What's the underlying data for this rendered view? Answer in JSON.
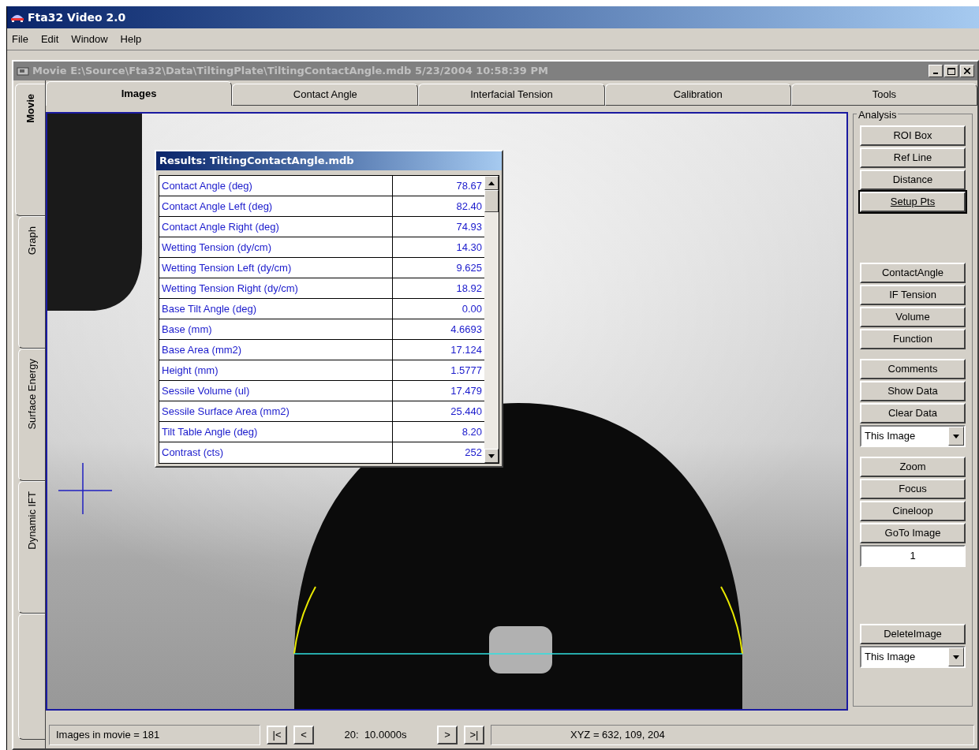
{
  "app": {
    "title": "Fta32 Video 2.0"
  },
  "menu": [
    "File",
    "Edit",
    "Window",
    "Help"
  ],
  "document": {
    "title": "Movie E:\\Source\\Fta32\\Data\\TiltingPlate\\TiltingContactAngle.mdb 5/23/2004 10:58:39 PM"
  },
  "side_tabs": [
    {
      "label": "Movie",
      "selected": true
    },
    {
      "label": "Graph",
      "selected": false
    },
    {
      "label": "Surface Energy",
      "selected": false
    },
    {
      "label": "Dynamic IFT",
      "selected": false
    }
  ],
  "tabs": [
    {
      "label": "Images",
      "selected": true
    },
    {
      "label": "Contact Angle",
      "selected": false
    },
    {
      "label": "Interfacial Tension",
      "selected": false
    },
    {
      "label": "Calibration",
      "selected": false
    },
    {
      "label": "Tools",
      "selected": false
    }
  ],
  "results": {
    "title": "Results: TiltingContactAngle.mdb",
    "rows": [
      {
        "label": "Contact Angle (deg)",
        "value": "78.67"
      },
      {
        "label": "Contact Angle Left (deg)",
        "value": "82.40"
      },
      {
        "label": "Contact Angle Right (deg)",
        "value": "74.93"
      },
      {
        "label": "Wetting Tension (dy/cm)",
        "value": "14.30"
      },
      {
        "label": "Wetting Tension Left (dy/cm)",
        "value": "9.625"
      },
      {
        "label": "Wetting Tension Right (dy/cm)",
        "value": "18.92"
      },
      {
        "label": "Base Tilt Angle (deg)",
        "value": "0.00"
      },
      {
        "label": "Base (mm)",
        "value": "4.6693"
      },
      {
        "label": "Base Area (mm2)",
        "value": "17.124"
      },
      {
        "label": "Height (mm)",
        "value": "1.5777"
      },
      {
        "label": "Sessile Volume (ul)",
        "value": "17.479"
      },
      {
        "label": "Sessile Surface Area (mm2)",
        "value": "25.440"
      },
      {
        "label": "Tilt Table Angle (deg)",
        "value": "8.20"
      },
      {
        "label": "Contrast (cts)",
        "value": "252"
      }
    ]
  },
  "analysis": {
    "title": "Analysis",
    "groups": [
      [
        {
          "kind": "button",
          "label": "ROI Box",
          "focused": false
        },
        {
          "kind": "button",
          "label": "Ref Line",
          "focused": false
        },
        {
          "kind": "button",
          "label": "Distance",
          "focused": false
        },
        {
          "kind": "button",
          "label": "Setup Pts",
          "focused": true
        }
      ],
      [
        {
          "kind": "button",
          "label": "ContactAngle",
          "focused": false
        },
        {
          "kind": "button",
          "label": "IF Tension",
          "focused": false
        },
        {
          "kind": "button",
          "label": "Volume",
          "focused": false
        },
        {
          "kind": "button",
          "label": "Function",
          "focused": false
        }
      ],
      [
        {
          "kind": "button",
          "label": "Comments",
          "focused": false
        },
        {
          "kind": "button",
          "label": "Show Data",
          "focused": false
        },
        {
          "kind": "button",
          "label": "Clear Data",
          "focused": false
        },
        {
          "kind": "select",
          "value": "This Image"
        }
      ],
      [
        {
          "kind": "button",
          "label": "Zoom",
          "focused": false
        },
        {
          "kind": "button",
          "label": "Focus",
          "focused": false
        },
        {
          "kind": "button",
          "label": "Cineloop",
          "focused": false
        },
        {
          "kind": "button",
          "label": "GoTo Image",
          "focused": false
        },
        {
          "kind": "field",
          "value": "1"
        }
      ],
      [
        {
          "kind": "button",
          "label": "DeleteImage",
          "focused": false
        },
        {
          "kind": "select",
          "value": "This Image"
        }
      ]
    ]
  },
  "status": {
    "count": "Images in movie = 181",
    "nav_back": [
      "|<",
      "<"
    ],
    "frame": "20:  10.0000s",
    "nav_forward": [
      ">",
      ">|"
    ],
    "xyz": "XYZ = 632, 109, 204"
  }
}
